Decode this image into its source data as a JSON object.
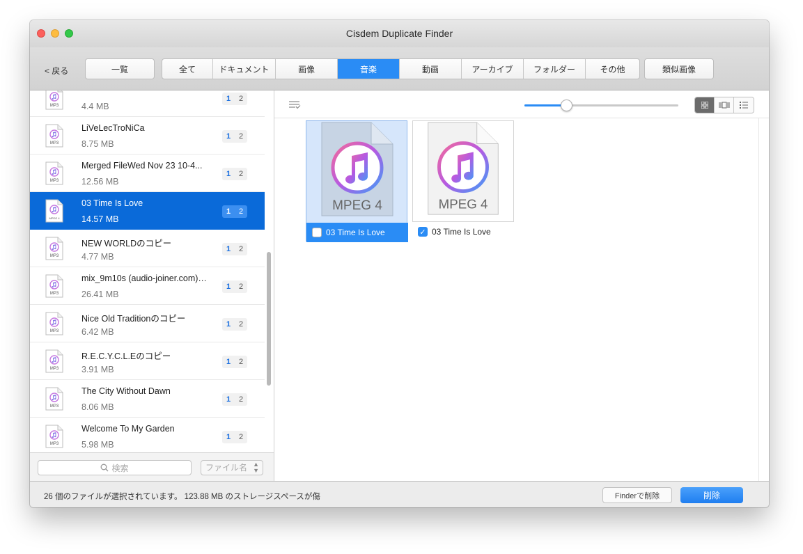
{
  "window": {
    "title": "Cisdem Duplicate Finder"
  },
  "toolbar": {
    "back_label": "< 戻る",
    "overview_label": "一覧",
    "tabs": [
      {
        "label": "全て"
      },
      {
        "label": "ドキュメント"
      },
      {
        "label": "画像"
      },
      {
        "label": "音楽"
      },
      {
        "label": "動画"
      },
      {
        "label": "アーカイブ"
      },
      {
        "label": "フォルダー"
      },
      {
        "label": "その他"
      }
    ],
    "active_tab": "音楽",
    "similar_images_label": "類似画像"
  },
  "sidebar": {
    "items": [
      {
        "name": "",
        "size": "4.4 MB",
        "type": "MP3",
        "count_a": "1",
        "count_b": "2"
      },
      {
        "name": "LiVeLecTroNiCa",
        "size": "8.75 MB",
        "type": "MP3",
        "count_a": "1",
        "count_b": "2"
      },
      {
        "name": "Merged FileWed Nov 23 10-4...",
        "size": "12.56 MB",
        "type": "MP3",
        "count_a": "1",
        "count_b": "2"
      },
      {
        "name": "03 Time Is Love",
        "size": "14.57 MB",
        "type": "MPEG 4",
        "count_a": "1",
        "count_b": "2",
        "selected": true
      },
      {
        "name": "NEW WORLDのコピー",
        "size": "4.77 MB",
        "type": "MP3",
        "count_a": "1",
        "count_b": "2"
      },
      {
        "name": "mix_9m10s (audio-joiner.com)…",
        "size": "26.41 MB",
        "type": "MP3",
        "count_a": "1",
        "count_b": "2"
      },
      {
        "name": "Nice Old Traditionのコピー",
        "size": "6.42 MB",
        "type": "MP3",
        "count_a": "1",
        "count_b": "2"
      },
      {
        "name": "R.E.C.Y.C.L.Eのコピー",
        "size": "3.91 MB",
        "type": "MP3",
        "count_a": "1",
        "count_b": "2"
      },
      {
        "name": "The City Without Dawn",
        "size": "8.06 MB",
        "type": "MP3",
        "count_a": "1",
        "count_b": "2"
      },
      {
        "name": "Welcome To My Garden",
        "size": "5.98 MB",
        "type": "MP3",
        "count_a": "1",
        "count_b": "2"
      }
    ],
    "search_placeholder": "検索",
    "sort_label": "ファイル名"
  },
  "main": {
    "cards": [
      {
        "format": "MPEG 4",
        "label": "03 Time Is Love",
        "checked": false,
        "highlighted": true
      },
      {
        "format": "MPEG 4",
        "label": "03 Time Is Love",
        "checked": true,
        "highlighted": false
      }
    ],
    "zoom_fraction": 0.27
  },
  "status": {
    "text": "26 個のファイルが選択されています。 123.88 MB のストレージスペースが傷",
    "finder_delete_label": "Finderで削除",
    "delete_label": "削除"
  },
  "colors": {
    "accent": "#2a8cf5",
    "selection": "#0a6ad9"
  },
  "icons": [
    "music-file-icon",
    "search-icon",
    "list-toggle-icon",
    "grid-view-icon",
    "carousel-view-icon",
    "list-view-icon"
  ]
}
